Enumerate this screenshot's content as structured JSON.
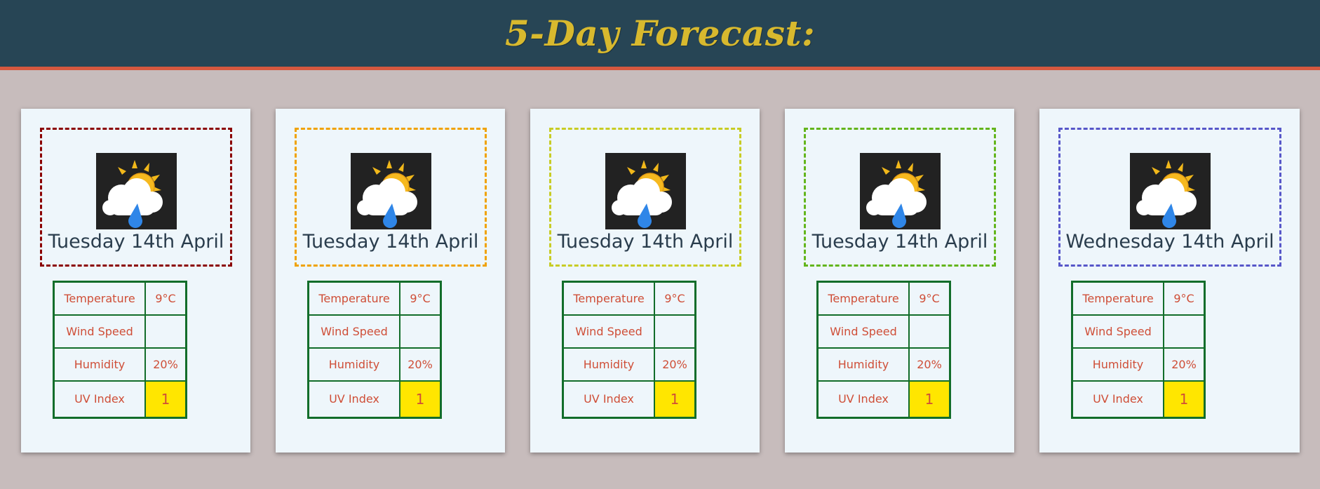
{
  "header": {
    "title": "5-Day Forecast:"
  },
  "colors": {
    "header_bg": "#274555",
    "header_border": "#d6583f",
    "title": "#d8b92e",
    "page_bg": "#c7bcbc",
    "card_bg": "#eef6fb",
    "table_border": "#126d2a",
    "table_text": "#cf4e37",
    "uv_highlight": "#ffe600"
  },
  "forecast": [
    {
      "date": "Tuesday 14th April",
      "icon": "partly-cloudy-rain-icon",
      "border_color": "#8b0000",
      "stats": [
        {
          "label": "Temperature",
          "value": "9°C"
        },
        {
          "label": "Wind Speed",
          "value": ""
        },
        {
          "label": "Humidity",
          "value": "20%"
        },
        {
          "label": "UV Index",
          "value": "1"
        }
      ]
    },
    {
      "date": "Tuesday 14th April",
      "icon": "partly-cloudy-rain-icon",
      "border_color": "#f0a202",
      "stats": [
        {
          "label": "Temperature",
          "value": "9°C"
        },
        {
          "label": "Wind Speed",
          "value": ""
        },
        {
          "label": "Humidity",
          "value": "20%"
        },
        {
          "label": "UV Index",
          "value": "1"
        }
      ]
    },
    {
      "date": "Tuesday 14th April",
      "icon": "partly-cloudy-rain-icon",
      "border_color": "#c8cc24",
      "stats": [
        {
          "label": "Temperature",
          "value": "9°C"
        },
        {
          "label": "Wind Speed",
          "value": ""
        },
        {
          "label": "Humidity",
          "value": "20%"
        },
        {
          "label": "UV Index",
          "value": "1"
        }
      ]
    },
    {
      "date": "Tuesday 14th April",
      "icon": "partly-cloudy-rain-icon",
      "border_color": "#63b51c",
      "stats": [
        {
          "label": "Temperature",
          "value": "9°C"
        },
        {
          "label": "Wind Speed",
          "value": ""
        },
        {
          "label": "Humidity",
          "value": "20%"
        },
        {
          "label": "UV Index",
          "value": "1"
        }
      ]
    },
    {
      "date": "Wednesday 14th April",
      "icon": "partly-cloudy-rain-icon",
      "border_color": "#5757c9",
      "stats": [
        {
          "label": "Temperature",
          "value": "9°C"
        },
        {
          "label": "Wind Speed",
          "value": ""
        },
        {
          "label": "Humidity",
          "value": "20%"
        },
        {
          "label": "UV Index",
          "value": "1"
        }
      ]
    }
  ]
}
